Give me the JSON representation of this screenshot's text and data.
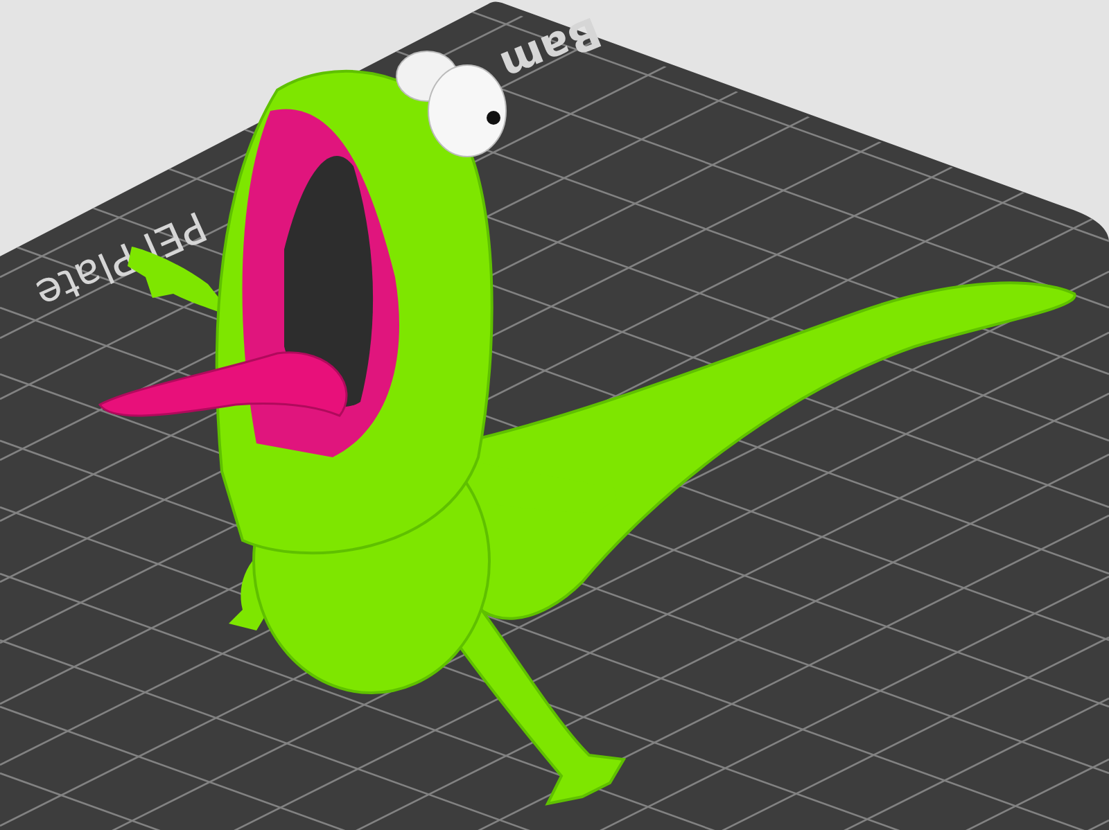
{
  "build_plate": {
    "label_1": "Bam",
    "label_2": "PEI Plate"
  }
}
